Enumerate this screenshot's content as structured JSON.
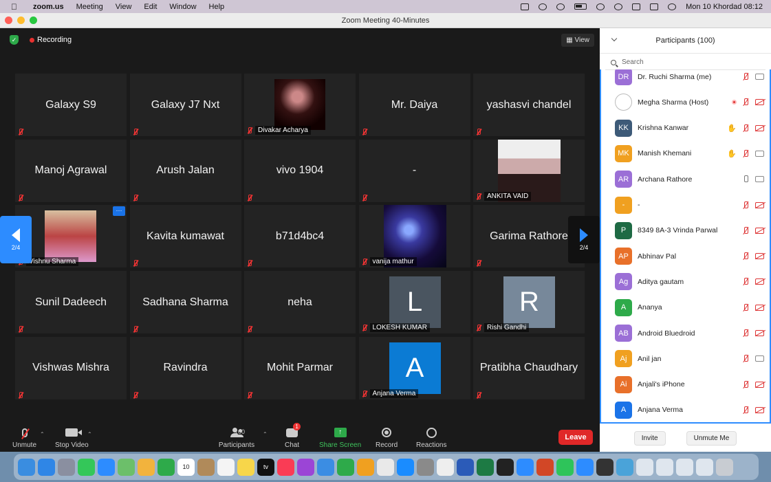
{
  "menubar": {
    "app": "zoom.us",
    "items": [
      "Meeting",
      "View",
      "Edit",
      "Window",
      "Help"
    ],
    "datetime": "Mon 10 Khordad  08:12"
  },
  "window": {
    "title": "Zoom Meeting   40-Minutes"
  },
  "meeting": {
    "recording_label": "Recording",
    "view_label": "View",
    "page_left": "2/4",
    "page_right": "2/4",
    "tiles": [
      {
        "name": "Galaxy S9",
        "kind": "text"
      },
      {
        "name": "Galaxy J7 Nxt",
        "kind": "text"
      },
      {
        "name": "Divakar Acharya",
        "kind": "photo",
        "photo": "ph-divakar"
      },
      {
        "name": "Mr. Daiya",
        "kind": "text"
      },
      {
        "name": "yashasvi  chandel",
        "kind": "text"
      },
      {
        "name": "Manoj Agrawal",
        "kind": "text"
      },
      {
        "name": "Arush  Jalan",
        "kind": "text"
      },
      {
        "name": "vivo 1904",
        "kind": "text"
      },
      {
        "name": "-",
        "kind": "text"
      },
      {
        "name": "ANKITA VAID",
        "kind": "photo",
        "photo": "ph-ankita"
      },
      {
        "name": "Vishnu Sharma",
        "kind": "photo",
        "photo": "ph-vishnu",
        "menu": "···"
      },
      {
        "name": "Kavita kumawat",
        "kind": "text"
      },
      {
        "name": "b71d4bc4",
        "kind": "text"
      },
      {
        "name": "vanija mathur",
        "kind": "photo",
        "photo": "ph-vanija"
      },
      {
        "name": "Garima Rathore",
        "kind": "text"
      },
      {
        "name": "Sunil Dadeech",
        "kind": "text"
      },
      {
        "name": "Sadhana Sharma",
        "kind": "text"
      },
      {
        "name": "neha",
        "kind": "text"
      },
      {
        "name": "LOKESH KUMAR",
        "kind": "avatar",
        "initial": "L",
        "color": "#4a5560"
      },
      {
        "name": "Rishi Gandhi",
        "kind": "avatar",
        "initial": "R",
        "color": "#77889a"
      },
      {
        "name": "Vishwas Mishra",
        "kind": "text"
      },
      {
        "name": "Ravindra",
        "kind": "text"
      },
      {
        "name": "Mohit Parmar",
        "kind": "text"
      },
      {
        "name": "Anjana Verma",
        "kind": "avatar",
        "initial": "A",
        "color": "#0b7bd4"
      },
      {
        "name": "Pratibha Chaudhary",
        "kind": "text"
      }
    ]
  },
  "toolbar": {
    "unmute": "Unmute",
    "stop_video": "Stop Video",
    "participants": "Participants",
    "participants_count": "100",
    "chat": "Chat",
    "chat_badge": "1",
    "share_screen": "Share Screen",
    "record": "Record",
    "reactions": "Reactions",
    "leave": "Leave"
  },
  "panel": {
    "title": "Participants (100)",
    "search_placeholder": "Search",
    "invite": "Invite",
    "unmute_me": "Unmute Me",
    "participants": [
      {
        "initials": "DR",
        "name": "Dr. Ruchi Sharma (me)",
        "color": "#9b6fd6",
        "mic": "muted",
        "cam": "on"
      },
      {
        "initials": "",
        "name": "Megha Sharma (Host)",
        "color": "#ffffff",
        "mic": "muted",
        "cam": "off",
        "rec": true
      },
      {
        "initials": "KK",
        "name": "Krishna Kanwar",
        "color": "#3d5a78",
        "mic": "muted",
        "cam": "off",
        "hand": true
      },
      {
        "initials": "MK",
        "name": "Manish Khemani",
        "color": "#f0a020",
        "mic": "muted",
        "cam": "on",
        "hand": true
      },
      {
        "initials": "AR",
        "name": "Archana Rathore",
        "color": "#9b6fd6",
        "mic": "on",
        "cam": "on"
      },
      {
        "initials": "-",
        "name": "-",
        "color": "#f0a020",
        "mic": "muted",
        "cam": "off"
      },
      {
        "initials": "P",
        "name": "8349 8A-3 Vrinda Parwal",
        "color": "#1e6a44",
        "mic": "muted",
        "cam": "off"
      },
      {
        "initials": "AP",
        "name": "Abhinav Pal",
        "color": "#e8702a",
        "mic": "muted",
        "cam": "off"
      },
      {
        "initials": "Ag",
        "name": "Aditya gautam",
        "color": "#9b6fd6",
        "mic": "muted",
        "cam": "off"
      },
      {
        "initials": "A",
        "name": "Ananya",
        "color": "#2eaa4a",
        "mic": "muted",
        "cam": "off"
      },
      {
        "initials": "AB",
        "name": "Android Bluedroid",
        "color": "#9b6fd6",
        "mic": "muted",
        "cam": "off"
      },
      {
        "initials": "Aj",
        "name": "Anil jan",
        "color": "#f0a020",
        "mic": "muted",
        "cam": "on"
      },
      {
        "initials": "Ai",
        "name": "Anjali's iPhone",
        "color": "#e8702a",
        "mic": "muted",
        "cam": "off"
      },
      {
        "initials": "A",
        "name": "Anjana Verma",
        "color": "#1a73e8",
        "mic": "muted",
        "cam": "off"
      }
    ]
  },
  "dock": {
    "icons": [
      {
        "name": "finder-icon",
        "color": "#3a8de0"
      },
      {
        "name": "safari-icon",
        "color": "#2f86e6"
      },
      {
        "name": "launchpad-icon",
        "color": "#8a8fa0"
      },
      {
        "name": "messages-icon",
        "color": "#34c759"
      },
      {
        "name": "mail-icon",
        "color": "#2d8cff"
      },
      {
        "name": "maps-icon",
        "color": "#6cbf6a"
      },
      {
        "name": "photos-icon",
        "color": "#f2b33d"
      },
      {
        "name": "facetime-icon",
        "color": "#2eaa4a"
      },
      {
        "name": "calendar-icon",
        "color": "#ffffff",
        "text": "10"
      },
      {
        "name": "contacts-icon",
        "color": "#b08a5a"
      },
      {
        "name": "reminders-icon",
        "color": "#f4f4f4"
      },
      {
        "name": "notes-icon",
        "color": "#f7d64a"
      },
      {
        "name": "appletv-icon",
        "color": "#111111",
        "text": "tv"
      },
      {
        "name": "music-icon",
        "color": "#fa3c55"
      },
      {
        "name": "podcasts-icon",
        "color": "#9b45d6"
      },
      {
        "name": "keynote-icon",
        "color": "#3b8de3"
      },
      {
        "name": "numbers-icon",
        "color": "#2eaa4a"
      },
      {
        "name": "pages-icon",
        "color": "#f0a020"
      },
      {
        "name": "chrome-icon",
        "color": "#e9e9e9"
      },
      {
        "name": "appstore-icon",
        "color": "#1a8cff"
      },
      {
        "name": "settings-icon",
        "color": "#8a8a8a"
      },
      {
        "name": "textedit-icon",
        "color": "#eeeeee"
      },
      {
        "name": "word-icon",
        "color": "#2b5bb8"
      },
      {
        "name": "excel-icon",
        "color": "#1d7a44"
      },
      {
        "name": "activity-monitor-icon",
        "color": "#222222"
      },
      {
        "name": "bluetooth-icon",
        "color": "#2d8cff"
      },
      {
        "name": "powerpoint-icon",
        "color": "#d24726"
      },
      {
        "name": "whatsapp-icon",
        "color": "#2ec45a"
      },
      {
        "name": "zoom-icon",
        "color": "#2d8cff"
      },
      {
        "name": "quicktime-icon",
        "color": "#333333"
      },
      {
        "name": "preview-icon",
        "color": "#4aa3d9"
      },
      {
        "name": "doc-thumb-1-icon",
        "color": "#dfe6ee"
      },
      {
        "name": "doc-thumb-2-icon",
        "color": "#dfe6ee"
      },
      {
        "name": "doc-thumb-3-icon",
        "color": "#dfe6ee"
      },
      {
        "name": "doc-thumb-4-icon",
        "color": "#dfe6ee"
      },
      {
        "name": "trash-icon",
        "color": "#c8ccd2"
      }
    ]
  }
}
